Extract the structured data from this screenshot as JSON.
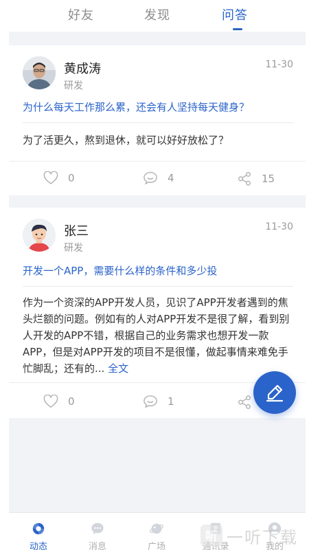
{
  "tabs": [
    {
      "label": "好友"
    },
    {
      "label": "发现"
    },
    {
      "label": "问答",
      "active": true
    }
  ],
  "posts": [
    {
      "author": "黄成涛",
      "role": "研发",
      "date": "11-30",
      "question": "为什么每天工作那么累，还会有人坚持每天健身？",
      "answer": "为了活更久，熬到退休，就可以好好放松了？",
      "likes": "0",
      "comments": "4",
      "shares": "15"
    },
    {
      "author": "张三",
      "role": "研发",
      "date": "11-30",
      "question": "开发一个APP，需要什么样的条件和多少投",
      "answer": "作为一个资深的APP开发人员，见识了APP开发者遇到的焦头烂额的问题。例如有的人对APP开发不是很了解，看到别人开发的APP不错，根据自己的业务需求也想开发一款APP，但是对APP开发的项目不是很懂，做起事情来难免手忙脚乱；还有的...",
      "more_label": "全文",
      "likes": "0",
      "comments": "1"
    }
  ],
  "bottom_nav": [
    {
      "label": "动态",
      "icon": "feed-icon",
      "active": true
    },
    {
      "label": "消息",
      "icon": "message-icon"
    },
    {
      "label": "广场",
      "icon": "planet-icon"
    },
    {
      "label": "通讯录",
      "icon": "contacts-icon"
    },
    {
      "label": "我的",
      "icon": "profile-icon"
    }
  ],
  "watermark": {
    "logo": "听",
    "text": "一听下载"
  },
  "colors": {
    "accent": "#2a63c9",
    "muted": "#9a9a9a",
    "background": "#f2f3f7"
  }
}
